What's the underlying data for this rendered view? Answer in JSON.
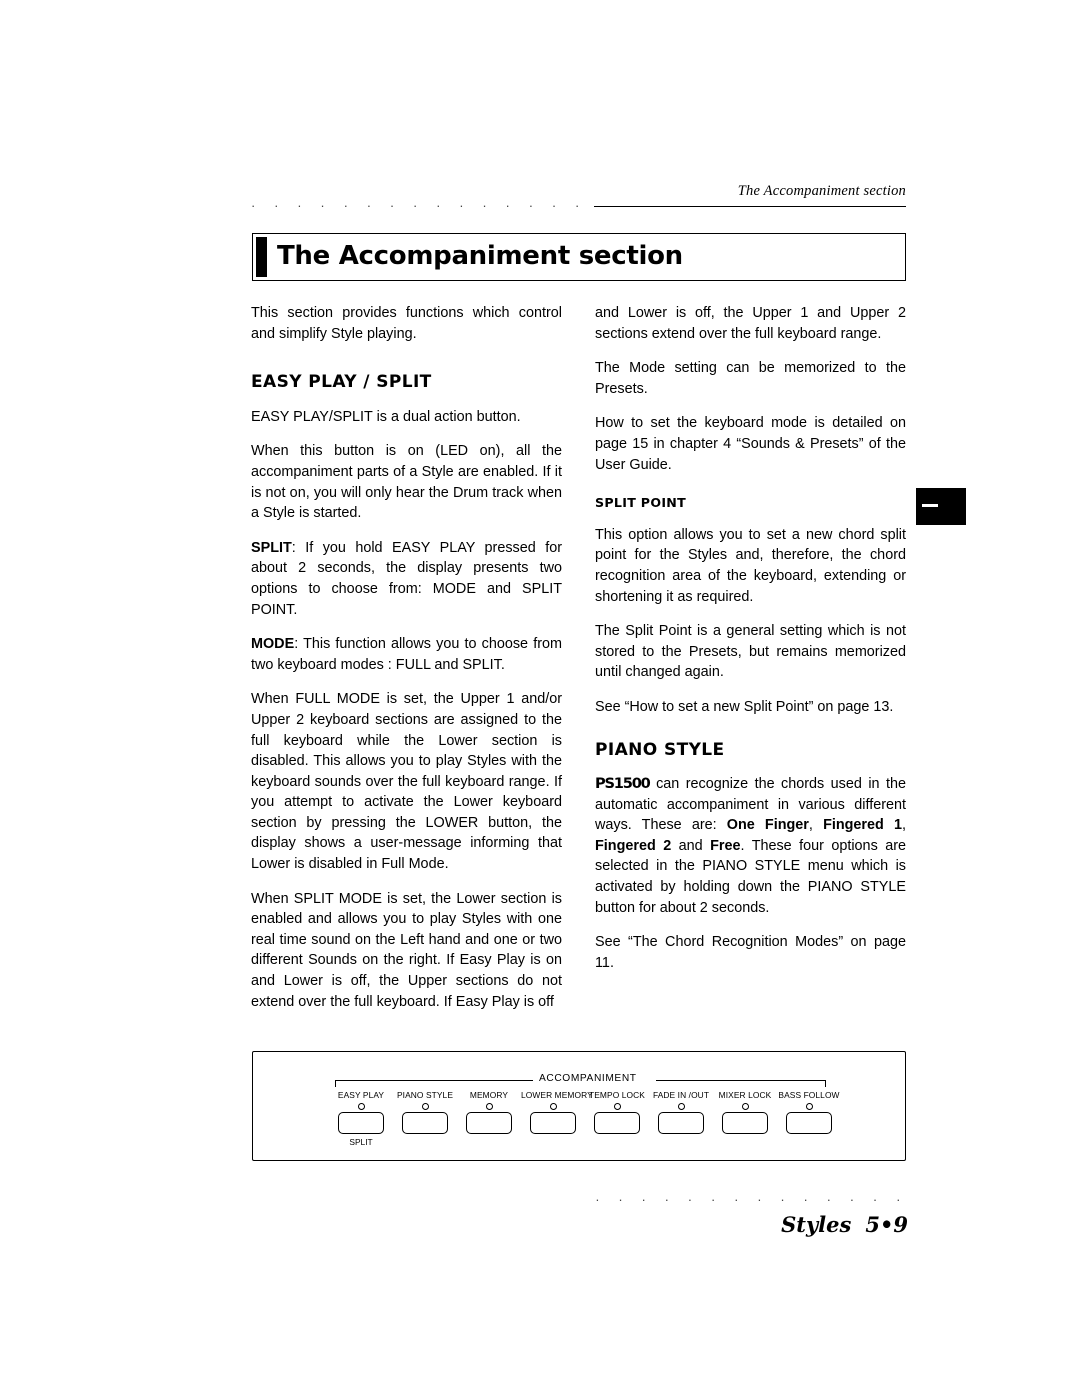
{
  "header": {
    "running_head": "The Accompaniment section",
    "dots": "· · · · · · · · · · · · · · · · · · · · · · · · ·"
  },
  "title": {
    "text": "The Accompaniment section"
  },
  "left_column": {
    "intro": "This section provides functions which control and simplify Style playing.",
    "heading_easy_play": "EASY PLAY / SPLIT",
    "p1": "EASY PLAY/SPLIT is a dual action button.",
    "p2": "When this button is on (LED on), all the accompaniment parts of a Style are enabled.  If it is not on, you will only hear the Drum track when a Style is started.",
    "p3_label": "SPLIT",
    "p3": ": If you hold EASY PLAY pressed for about 2 seconds, the display presents two options to choose from: MODE and SPLIT POINT.",
    "p4_label": "MODE",
    "p4": ": This function allows you to choose from two keyboard modes : FULL and SPLIT.",
    "p5": "When FULL MODE is set, the Upper 1 and/or Upper 2 keyboard sections are assigned to the full keyboard while the Lower section is disabled. This allows you to play Styles with the keyboard sounds over the full keyboard range.  If you attempt to activate the Lower keyboard section by pressing the LOWER button, the display shows a user-message informing that Lower is disabled in Full Mode.",
    "p6": "When SPLIT MODE is set, the Lower section is enabled and allows you to play Styles with one real time sound on the Left hand and one or two different Sounds on the right.  If Easy Play is on and Lower is off, the Upper sections do not extend over the full keyboard.  If Easy Play is off"
  },
  "right_column": {
    "p1": "and Lower is off, the Upper 1 and Upper 2 sections extend over the full keyboard range.",
    "p2": "The Mode setting can be memorized to the Presets.",
    "p3": "How to set the keyboard mode is detailed on page 15 in chapter 4 “Sounds & Presets” of the User Guide.",
    "heading_split_point": "SPLIT POINT",
    "p4": "This option allows you to set a new chord split point for the Styles and, therefore, the chord recognition area of the keyboard, extending or shortening it as required.",
    "p5": "The Split Point is a general setting which is not stored to the Presets, but remains memorized until changed again.",
    "p6": "See “How to set a new Split Point” on page 13.",
    "heading_piano_style": "PIANO STYLE",
    "p7_product": "PS1500",
    "p7_a": " can recognize the chords used in the automatic accompaniment in various different ways. These are: ",
    "p7_b1": "One Finger",
    "p7_sep1": ", ",
    "p7_b2": "Fingered 1",
    "p7_sep2": ", ",
    "p7_b3": "Fingered 2",
    "p7_sep3": " and ",
    "p7_b4": "Free",
    "p7_c": ".  These four options are selected in the PIANO STYLE menu which is activated by holding down the PIANO STYLE button for about 2 seconds.",
    "p8": "See “The Chord Recognition Modes” on page 11."
  },
  "panel": {
    "section_label": "ACCOMPANIMENT",
    "buttons": [
      {
        "caption": "EASY PLAY",
        "sub": "SPLIT"
      },
      {
        "caption": "PIANO STYLE",
        "sub": ""
      },
      {
        "caption": "MEMORY",
        "sub": ""
      },
      {
        "caption": "LOWER MEMORY",
        "sub": ""
      },
      {
        "caption": "TEMPO LOCK",
        "sub": ""
      },
      {
        "caption": "FADE IN /OUT",
        "sub": ""
      },
      {
        "caption": "MIXER LOCK",
        "sub": ""
      },
      {
        "caption": "BASS FOLLOW",
        "sub": ""
      }
    ]
  },
  "footer": {
    "dots": "· · · · · · · · · · · · · · · · · · · ·",
    "label": "Styles",
    "page": "5•9"
  }
}
